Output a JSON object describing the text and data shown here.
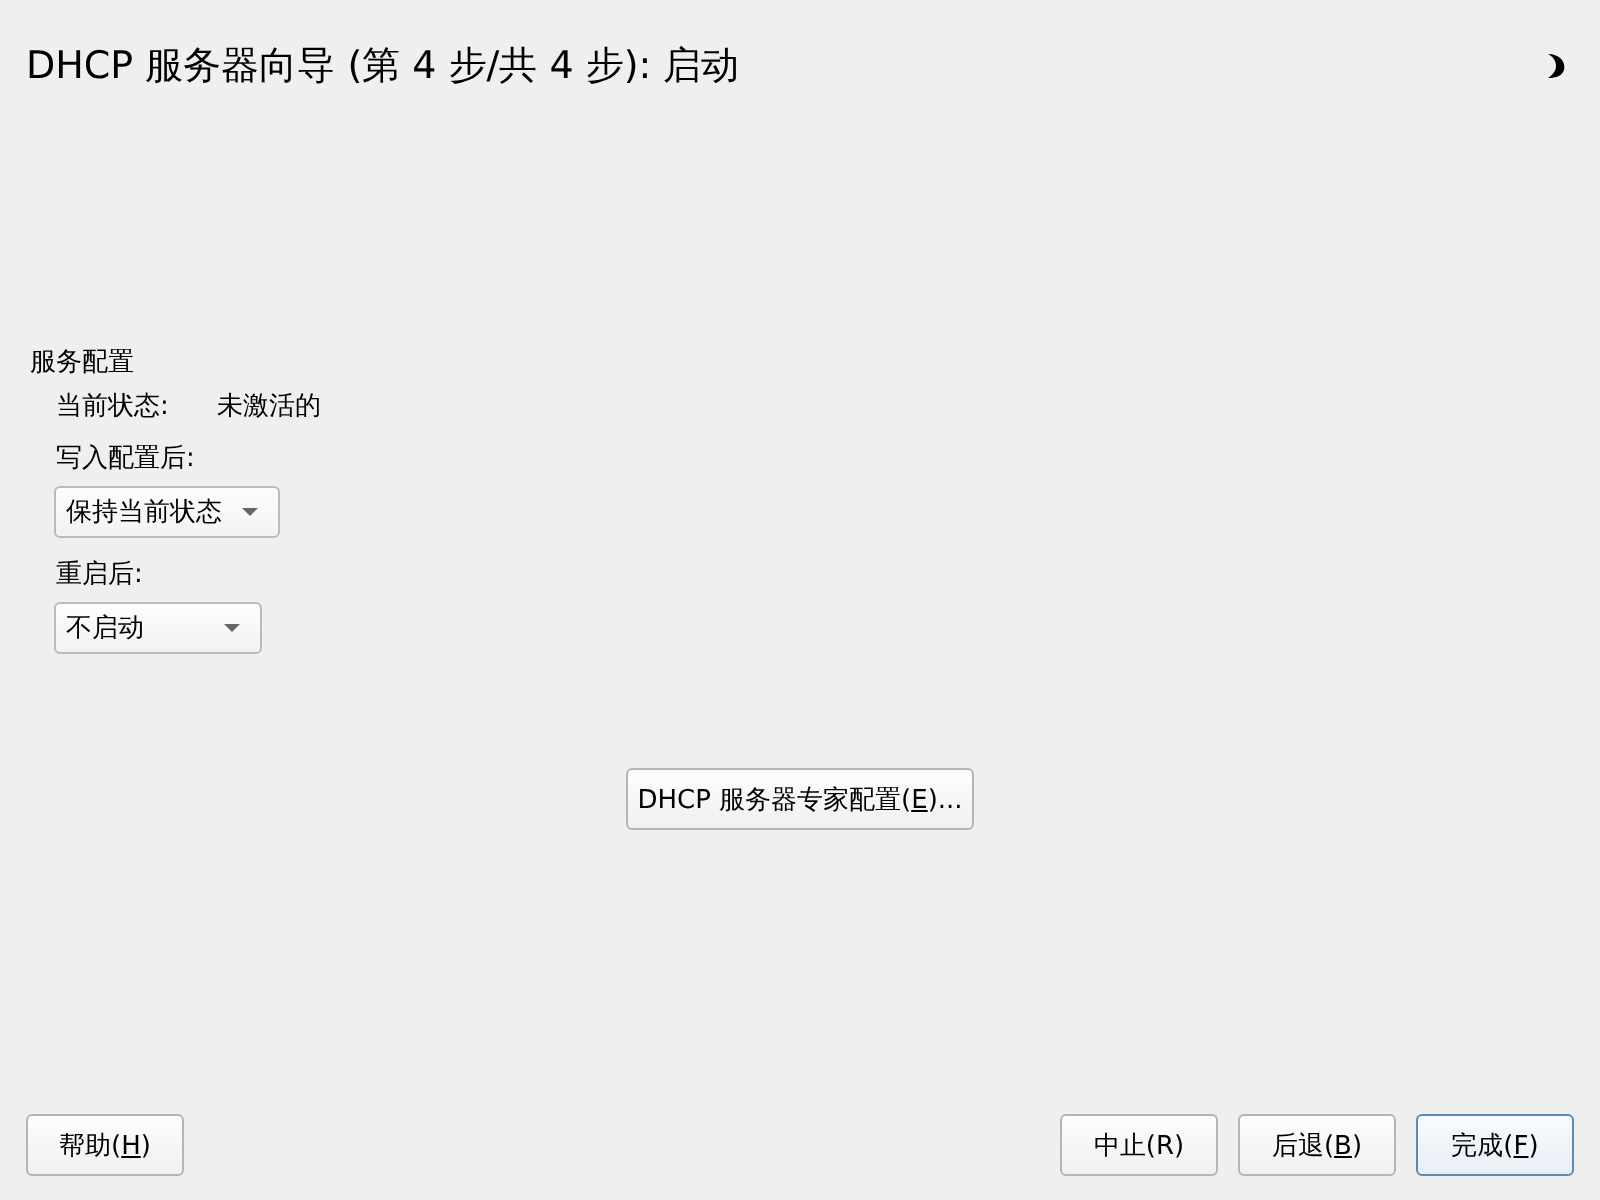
{
  "window": {
    "title": "DHCP 服务器向导 (第 4 步/共 4 步): 启动"
  },
  "section": {
    "title": "服务配置",
    "status_label": "当前状态:",
    "status_value": "未激活的",
    "fields": [
      {
        "label": "写入配置后:",
        "value": "保持当前状态"
      },
      {
        "label": "重启后:",
        "value": "不启动"
      }
    ]
  },
  "expert_button": {
    "text": "DHCP 服务器专家配置(",
    "mnemonic": "E",
    "tail": ")..."
  },
  "help_button": {
    "text": "帮助(",
    "mnemonic": "H",
    "tail": ")"
  },
  "buttons": [
    {
      "text": "中止(R)",
      "default": false
    },
    {
      "text": "后退(",
      "mnemonic": "B",
      "tail": ")",
      "default": false
    },
    {
      "text": "完成(",
      "mnemonic": "F",
      "tail": ")",
      "default": true
    }
  ]
}
